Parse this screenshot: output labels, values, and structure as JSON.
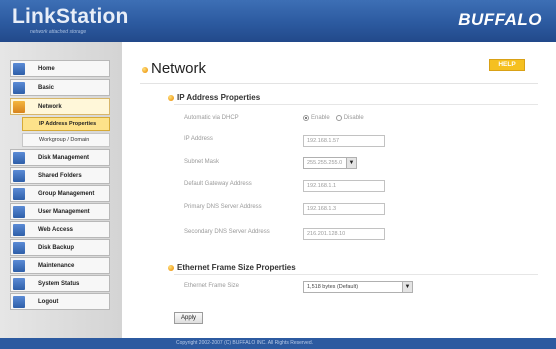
{
  "header": {
    "logo": "LinkStation",
    "tagline": "network attached storage",
    "brand": "BUFFALO"
  },
  "sidebar": {
    "items": [
      {
        "label": "Home",
        "icon": "home-icon"
      },
      {
        "label": "Basic",
        "icon": "basic-settings-icon"
      },
      {
        "label": "Network",
        "icon": "network-icon",
        "active": true
      },
      {
        "label": "IP Address Properties",
        "sub": true,
        "active": true
      },
      {
        "label": "Workgroup / Domain",
        "sub": true
      },
      {
        "label": "Disk Management",
        "icon": "disk-icon"
      },
      {
        "label": "Shared Folders",
        "icon": "folder-icon"
      },
      {
        "label": "Group Management",
        "icon": "group-icon"
      },
      {
        "label": "User Management",
        "icon": "user-icon"
      },
      {
        "label": "Web Access",
        "icon": "globe-icon"
      },
      {
        "label": "Disk Backup",
        "icon": "backup-icon"
      },
      {
        "label": "Maintenance",
        "icon": "wrench-icon"
      },
      {
        "label": "System Status",
        "icon": "status-icon"
      },
      {
        "label": "Logout",
        "icon": "logout-icon"
      }
    ]
  },
  "main": {
    "title": "Network",
    "help": "HELP",
    "ip_section": {
      "title": "IP Address Properties",
      "dhcp": {
        "label": "Automatic via DHCP",
        "enable": "Enable",
        "disable": "Disable",
        "selected": "Enable"
      },
      "ip": {
        "label": "IP Address",
        "value": "192.168.1.57"
      },
      "subnet": {
        "label": "Subnet Mask",
        "value": "255.255.255.0"
      },
      "gateway": {
        "label": "Default Gateway Address",
        "value": "192.168.1.1"
      },
      "dns1": {
        "label": "Primary DNS Server Address",
        "value": "192.168.1.3"
      },
      "dns2": {
        "label": "Secondary DNS Server Address",
        "value": "216.201.128.10"
      }
    },
    "frame_section": {
      "title": "Ethernet Frame Size Properties",
      "label": "Ethernet Frame Size",
      "value": "1,518  bytes (Default)"
    },
    "apply": "Apply"
  },
  "footer": {
    "copyright": "Copyright 2002-2007 (C) BUFFALO INC. All Rights Reserved."
  },
  "colors": {
    "header_blue": "#2c5aa0",
    "accent_orange": "#f0a020",
    "help_yellow": "#f5c020",
    "active_sub": "#fde28a"
  }
}
